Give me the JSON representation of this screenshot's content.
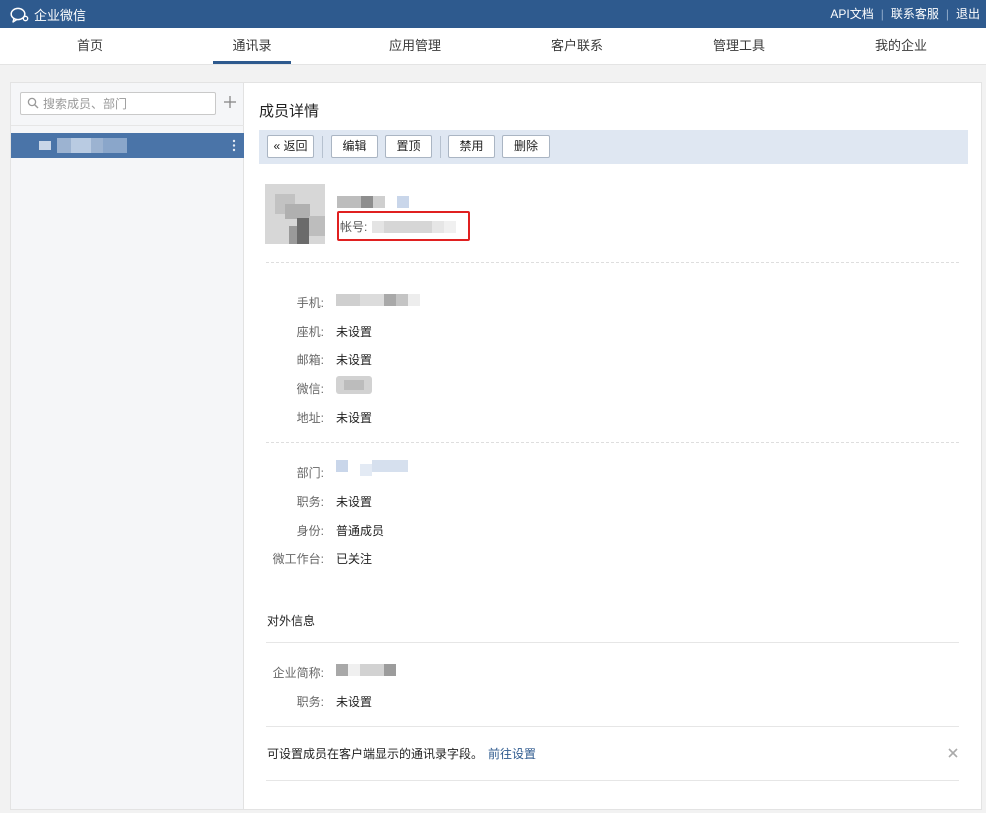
{
  "app": {
    "brand": "企业微信"
  },
  "topbar": {
    "links": [
      "API文档",
      "联系客服",
      "退出"
    ]
  },
  "nav": {
    "items": [
      "首页",
      "通讯录",
      "应用管理",
      "客户联系",
      "管理工具",
      "我的企业"
    ],
    "active_index": 1
  },
  "sidebar": {
    "search_placeholder": "搜索成员、部门"
  },
  "detail": {
    "title": "成员详情",
    "toolbar": {
      "back": "« 返回",
      "edit": "编辑",
      "pin": "置顶",
      "disable": "禁用",
      "delete": "删除"
    },
    "account_label": "帐号:",
    "fields_contact": [
      {
        "label": "手机:",
        "value": ""
      },
      {
        "label": "座机:",
        "value": "未设置"
      },
      {
        "label": "邮箱:",
        "value": "未设置"
      },
      {
        "label": "微信:",
        "value": ""
      },
      {
        "label": "地址:",
        "value": "未设置"
      }
    ],
    "fields_org": [
      {
        "label": "部门:",
        "value": ""
      },
      {
        "label": "职务:",
        "value": "未设置"
      },
      {
        "label": "身份:",
        "value": "普通成员"
      },
      {
        "label": "微工作台:",
        "value": "已关注"
      }
    ],
    "external": {
      "title": "对外信息",
      "fields": [
        {
          "label": "企业简称:",
          "value": ""
        },
        {
          "label": "职务:",
          "value": "未设置"
        }
      ]
    },
    "notice": {
      "text": "可设置成员在客户端显示的通讯录字段。",
      "link": "前往设置"
    }
  },
  "colors": {
    "topbar": "#2e5a8e",
    "selected_row": "#4a74a8",
    "toolbar_bg": "#dfe7f2",
    "highlight_box": "#e02020"
  }
}
